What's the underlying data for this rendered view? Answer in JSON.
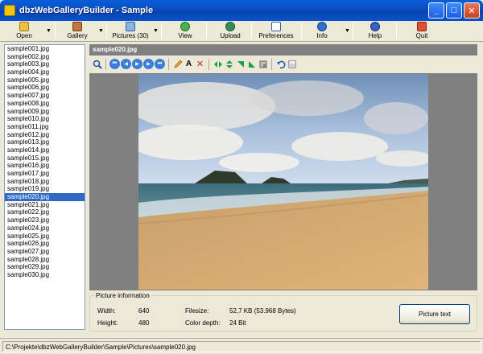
{
  "window": {
    "title": "dbzWebGalleryBuilder - Sample",
    "minimize": "_",
    "maximize": "□",
    "close": "✕"
  },
  "toolbar": {
    "open": "Open",
    "gallery": "Gallery",
    "pictures": "Pictures (30)",
    "view": "View",
    "upload": "Upload",
    "preferences": "Preferences",
    "info": "Info",
    "help": "Help",
    "quit": "Quit",
    "dropdown": "▼"
  },
  "files": [
    "sample001.jpg",
    "sample002.jpg",
    "sample003.jpg",
    "sample004.jpg",
    "sample005.jpg",
    "sample006.jpg",
    "sample007.jpg",
    "sample008.jpg",
    "sample009.jpg",
    "sample010.jpg",
    "sample011.jpg",
    "sample012.jpg",
    "sample013.jpg",
    "sample014.jpg",
    "sample015.jpg",
    "sample016.jpg",
    "sample017.jpg",
    "sample018.jpg",
    "sample019.jpg",
    "sample020.jpg",
    "sample021.jpg",
    "sample022.jpg",
    "sample023.jpg",
    "sample024.jpg",
    "sample025.jpg",
    "sample026.jpg",
    "sample027.jpg",
    "sample028.jpg",
    "sample029.jpg",
    "sample030.jpg"
  ],
  "selected_index": 19,
  "preview": {
    "title": "sample020.jpg"
  },
  "image_toolbar": {
    "first": "⏮",
    "prev": "◀",
    "play": "▶",
    "next": "▶",
    "last": "⏭",
    "rename": "A",
    "delete": "✕"
  },
  "info": {
    "legend": "Picture information",
    "width_label": "Width:",
    "width_value": "640",
    "height_label": "Height:",
    "height_value": "480",
    "filesize_label": "Filesize:",
    "filesize_value": "52,7 KB (53.968 Bytes)",
    "depth_label": "Color depth:",
    "depth_value": "24 Bit",
    "picture_text_button": "Picture text"
  },
  "status": {
    "path": "C:\\Projekte\\dbzWebGalleryBuilder\\Sample\\Pictures\\sample020.jpg"
  },
  "colors": {
    "title_blue": "#0a52cd",
    "selection": "#316ac5",
    "list_border": "#7f9db9"
  }
}
